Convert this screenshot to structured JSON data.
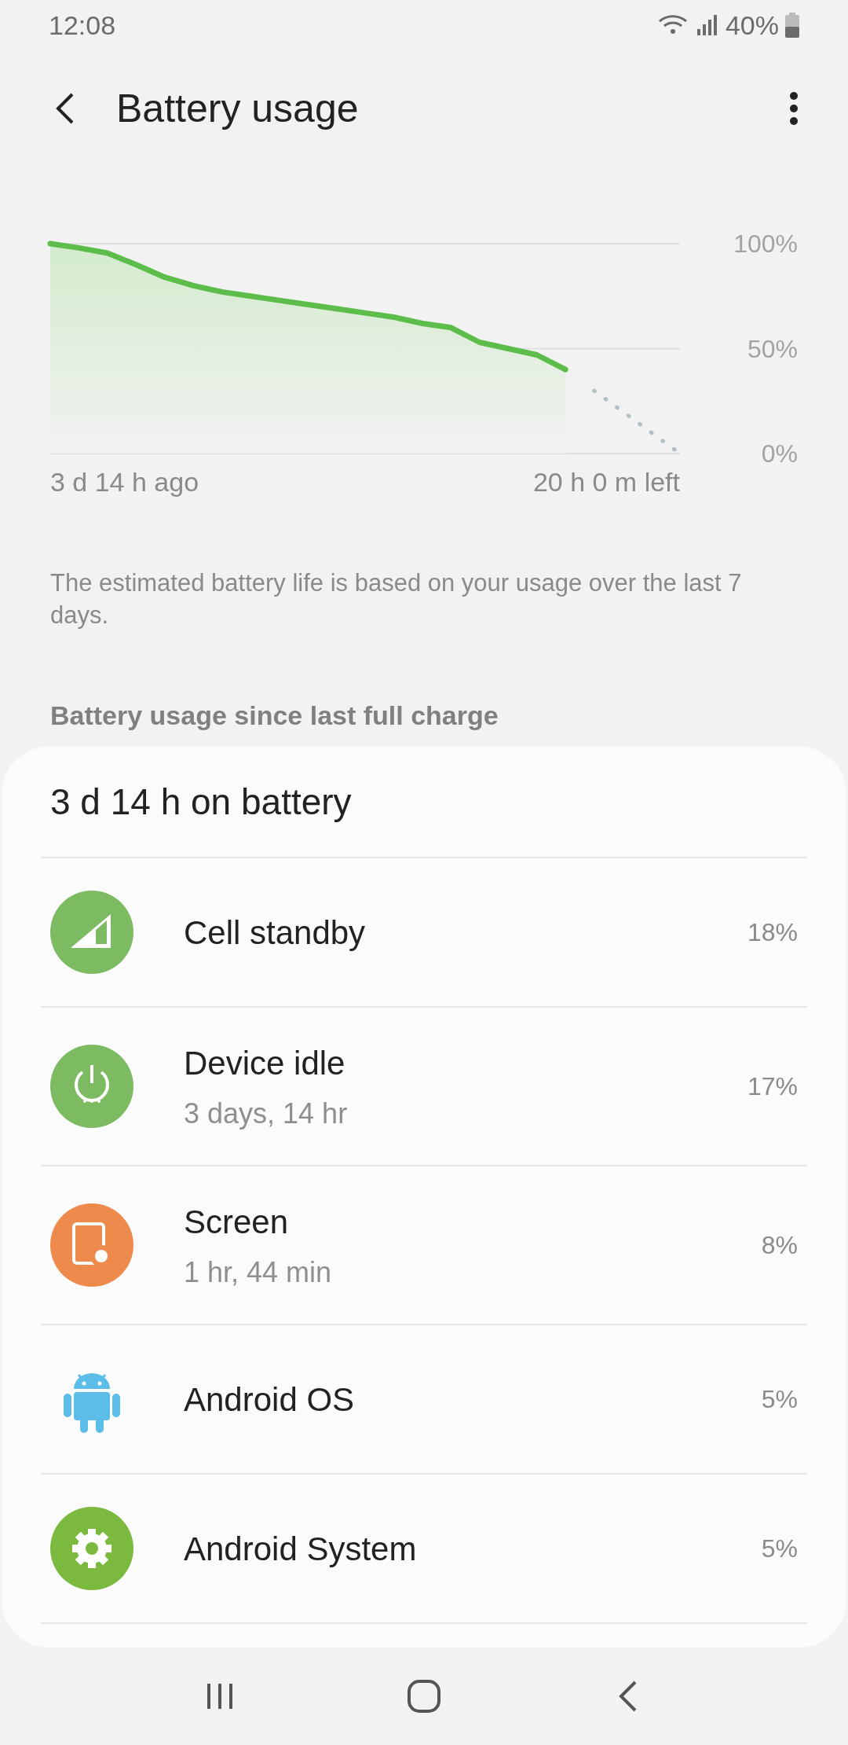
{
  "status_bar": {
    "time": "12:08",
    "battery": "40%"
  },
  "header": {
    "title": "Battery usage"
  },
  "chart_data": {
    "type": "area",
    "categories": [
      null,
      null,
      null,
      null,
      null,
      null,
      null,
      null,
      null,
      null,
      null,
      null,
      null,
      null,
      null,
      null,
      null,
      null,
      null,
      null,
      null,
      null,
      null
    ],
    "ylim": [
      0,
      100
    ],
    "series": [
      {
        "color": "#5cbd4a",
        "line_style": "solid",
        "values": [
          100,
          98,
          95.5,
          90,
          84,
          80,
          77,
          75,
          73,
          71,
          69,
          67,
          65,
          62,
          60,
          53,
          50,
          47,
          40,
          null,
          null,
          null,
          null
        ]
      },
      {
        "color": "#b4bfc4",
        "type": "line",
        "line_style": "dotted",
        "values": [
          null,
          null,
          null,
          null,
          null,
          null,
          null,
          null,
          null,
          null,
          null,
          null,
          null,
          null,
          null,
          null,
          null,
          null,
          null,
          30,
          20,
          10,
          0
        ]
      }
    ],
    "yticks": [
      {
        "value": 100,
        "label": "100%"
      },
      {
        "value": 50,
        "label": "50%"
      },
      {
        "value": 0,
        "label": "0%"
      }
    ]
  },
  "chart_range": {
    "start": "3 d 14 h ago",
    "end": "20 h 0 m left"
  },
  "note": "The estimated battery life is based on your usage over the last 7 days.",
  "section_title": "Battery usage since last full charge",
  "card": {
    "title": "3 d 14 h on battery",
    "items": [
      {
        "kind": "signal",
        "name": "Cell standby",
        "percent": "18%"
      },
      {
        "kind": "power",
        "name": "Device idle",
        "detail": "3 days, 14 hr",
        "percent": "17%"
      },
      {
        "kind": "screen",
        "name": "Screen",
        "detail": "1 hr, 44 min",
        "percent": "8%"
      },
      {
        "kind": "android",
        "name": "Android OS",
        "percent": "5%"
      },
      {
        "kind": "gear",
        "name": "Android System",
        "percent": "5%"
      }
    ]
  }
}
